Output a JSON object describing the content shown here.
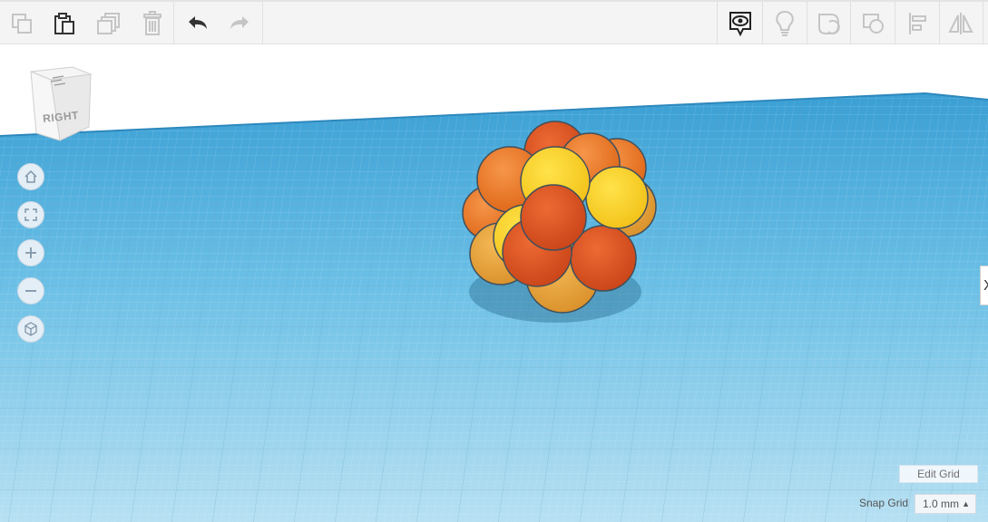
{
  "toolbar": {
    "left_tools": [
      {
        "name": "copy-icon",
        "enabled": false
      },
      {
        "name": "paste-icon",
        "enabled": true
      },
      {
        "name": "duplicate-icon",
        "enabled": false
      },
      {
        "name": "delete-icon",
        "enabled": false
      },
      {
        "name": "undo-icon",
        "enabled": true
      },
      {
        "name": "redo-icon",
        "enabled": false
      }
    ],
    "right_tools": [
      {
        "name": "show-all-icon",
        "enabled": true
      },
      {
        "name": "notes-lightbulb-icon",
        "enabled": false
      },
      {
        "name": "group-icon",
        "enabled": false
      },
      {
        "name": "ungroup-icon",
        "enabled": false
      },
      {
        "name": "align-icon",
        "enabled": false
      },
      {
        "name": "mirror-icon",
        "enabled": false
      }
    ]
  },
  "viewcube": {
    "face_label": "RIGHT"
  },
  "nav_controls": [
    "home-view-icon",
    "fit-view-icon",
    "zoom-in-icon",
    "zoom-out-icon",
    "perspective-icon"
  ],
  "workplane": {
    "grid_color": "#6ab7dd",
    "object_colors": [
      "#e8731f",
      "#dd5320",
      "#f7cf1c",
      "#e9a33a"
    ]
  },
  "grid_controls": {
    "edit_grid_label": "Edit Grid",
    "snap_grid_label": "Snap Grid",
    "snap_grid_value": "1.0 mm"
  },
  "side_tab_label": "X"
}
